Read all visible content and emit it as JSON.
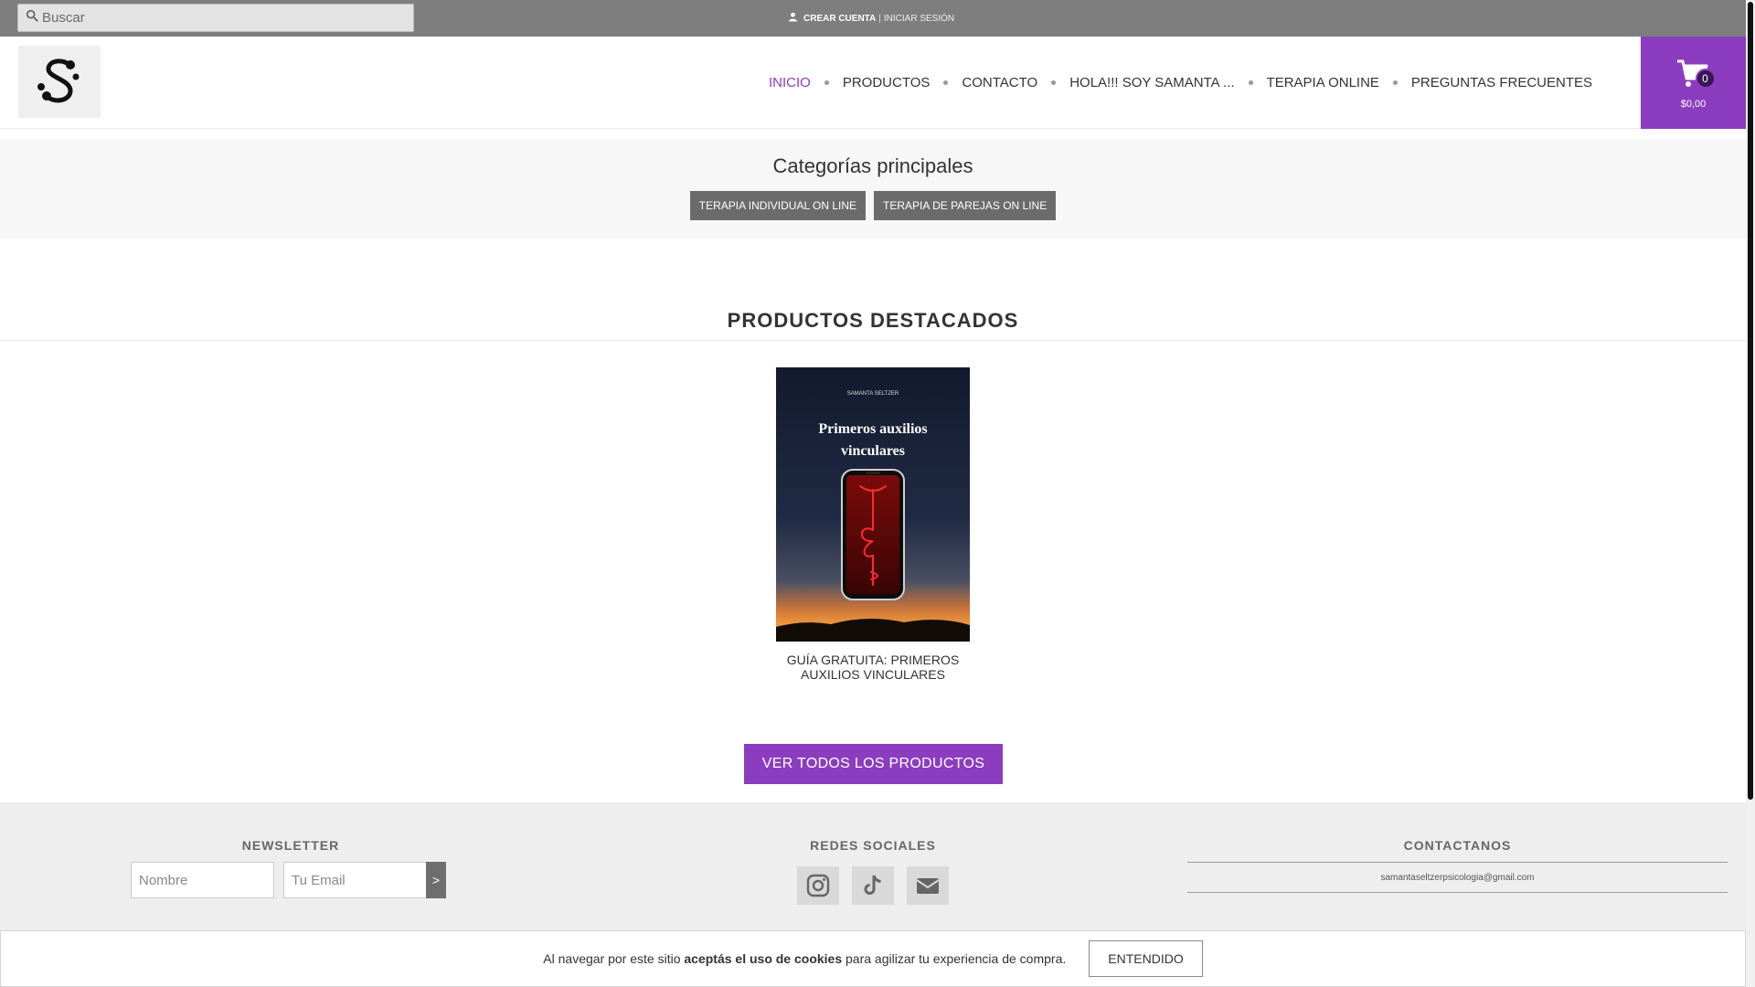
{
  "topbar": {
    "search_placeholder": "Buscar",
    "create_account": "CREAR CUENTA",
    "separator": "|",
    "login": "INICIAR SESIÓN"
  },
  "header": {
    "nav": [
      {
        "label": "INICIO",
        "active": true
      },
      {
        "label": "PRODUCTOS"
      },
      {
        "label": "CONTACTO"
      },
      {
        "label": "HOLA!!! SOY SAMANTA ..."
      },
      {
        "label": "TERAPIA ONLINE"
      },
      {
        "label": "PREGUNTAS FRECUENTES"
      }
    ],
    "cart": {
      "count": "0",
      "total": "$0,00"
    }
  },
  "categories": {
    "title": "Categorías principales",
    "items": [
      "TERAPIA INDIVIDUAL ON LINE",
      "TERAPIA DE PAREJAS ON LINE"
    ]
  },
  "featured": {
    "title": "PRODUCTOS DESTACADOS",
    "product": {
      "cover_author": "SAMANTA SELTZER",
      "cover_title_line1": "Primeros auxilios",
      "cover_title_line2": "vinculares",
      "name": "GUÍA GRATUITA: PRIMEROS AUXILIOS VINCULARES"
    },
    "view_all": "VER TODOS LOS PRODUCTOS"
  },
  "footer": {
    "newsletter": {
      "title": "NEWSLETTER",
      "name_placeholder": "Nombre",
      "email_placeholder": "Tu Email",
      "submit": ">"
    },
    "social": {
      "title": "REDES SOCIALES",
      "icons": [
        "instagram-icon",
        "tiktok-icon",
        "envelope-icon"
      ]
    },
    "contact": {
      "title": "CONTACTANOS",
      "email": "samantaseltzerpsicologia@gmail.com"
    }
  },
  "cookie": {
    "text_before": "Al navegar por este sitio ",
    "text_bold": "aceptás el uso de cookies",
    "text_after": " para agilizar tu experiencia de compra.",
    "button": "ENTENDIDO"
  },
  "colors": {
    "accent": "#8c3dbf",
    "topbar": "#7e7e7e",
    "chip": "#6b6b6b"
  }
}
